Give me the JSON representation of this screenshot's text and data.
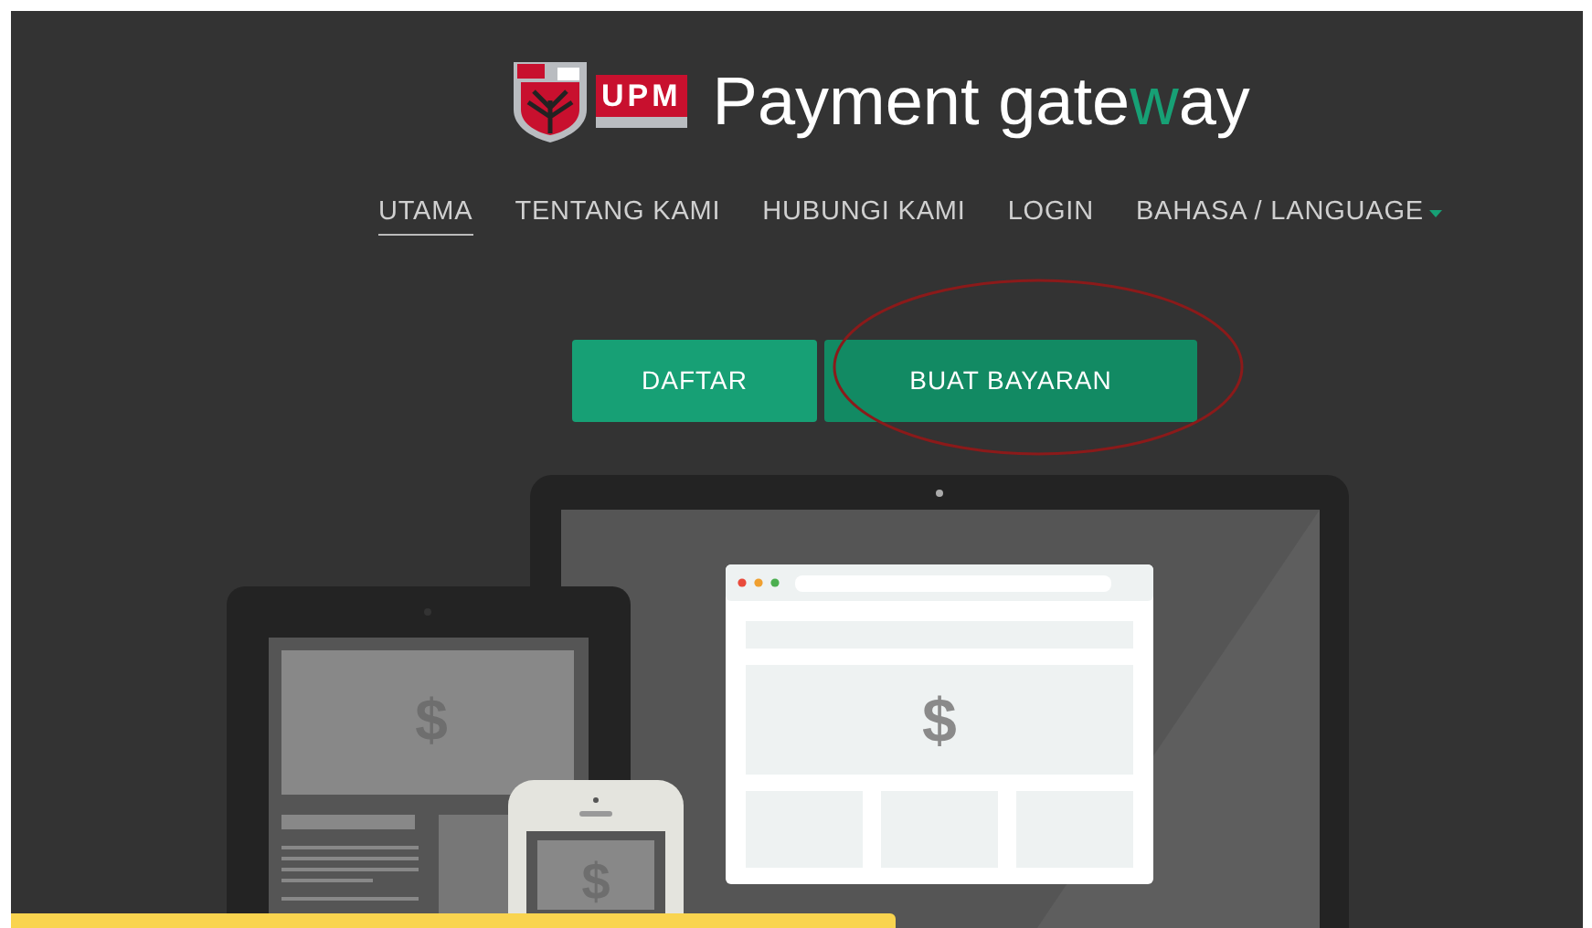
{
  "logo": {
    "wordmark": "UPM"
  },
  "title": [
    {
      "text": "Payment gate",
      "accent": false
    },
    {
      "text": "w",
      "accent": true
    },
    {
      "text": "ay",
      "accent": false
    }
  ],
  "nav": [
    {
      "label": "UTAMA",
      "selected": true,
      "kind": "link"
    },
    {
      "label": "TENTANG KAMI",
      "selected": false,
      "kind": "link"
    },
    {
      "label": "HUBUNGI KAMI",
      "selected": false,
      "kind": "link"
    },
    {
      "label": "LOGIN",
      "selected": false,
      "kind": "link"
    },
    {
      "label": "BAHASA / LANGUAGE",
      "selected": false,
      "kind": "dropdown"
    }
  ],
  "buttons": [
    {
      "label": "DAFTAR",
      "highlighted": false
    },
    {
      "label": "BUAT BAYARAN",
      "highlighted": true
    }
  ],
  "illustration": {
    "symbols": [
      "$",
      "$",
      "$"
    ]
  }
}
